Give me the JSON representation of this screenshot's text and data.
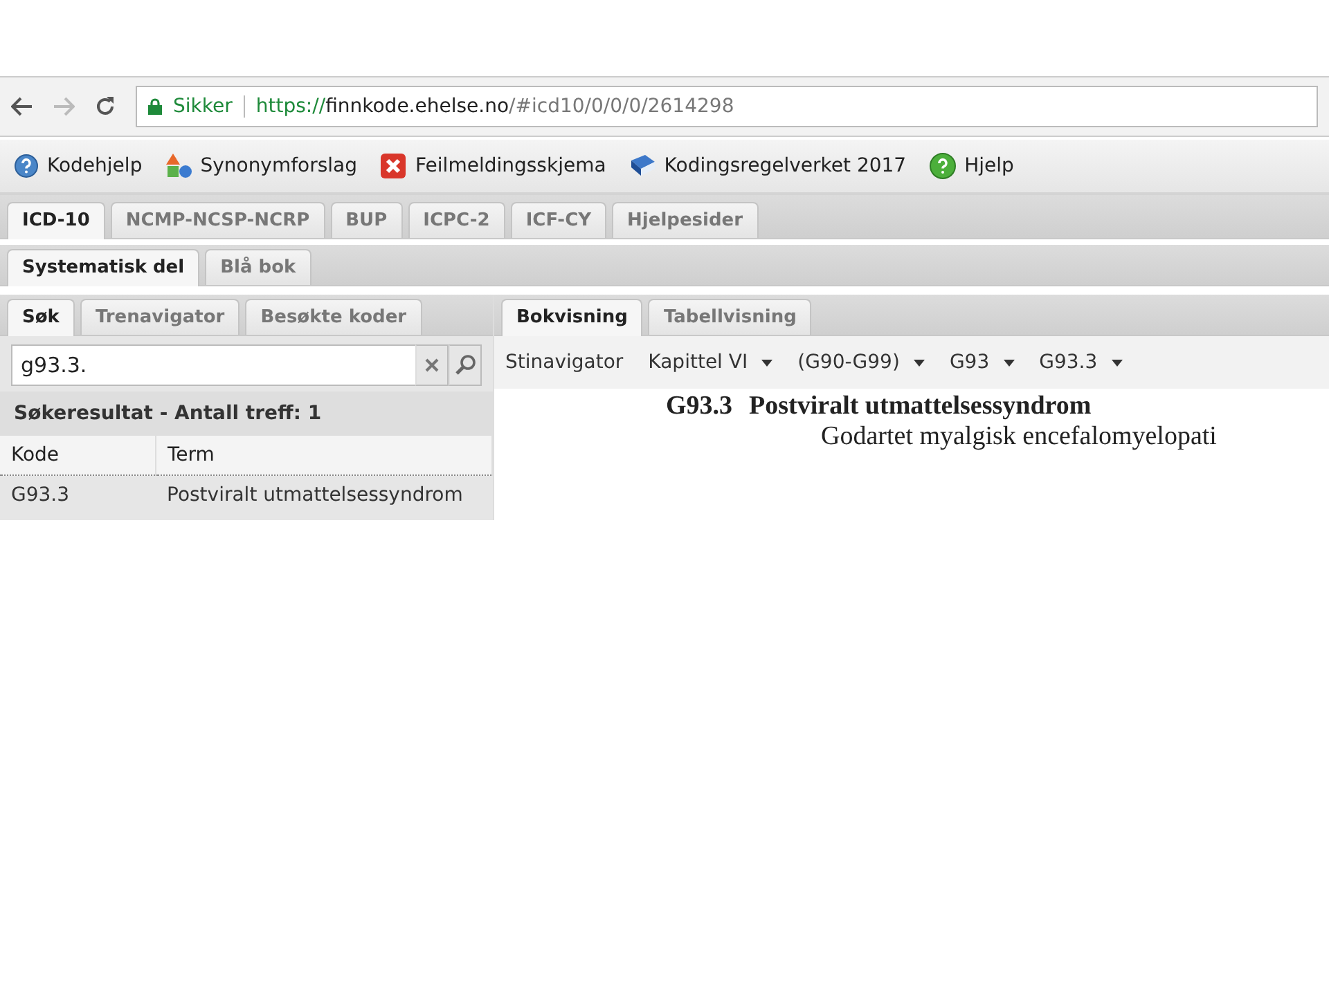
{
  "browser": {
    "security_label": "Sikker",
    "url": {
      "scheme": "https://",
      "host": "finnkode.ehelse.no",
      "path": "/#icd10/0/0/0/2614298"
    }
  },
  "toolbar": [
    {
      "kind": "help",
      "label": "Kodehjelp"
    },
    {
      "kind": "shapes",
      "label": "Synonymforslag"
    },
    {
      "kind": "error",
      "label": "Feilmeldingsskjema"
    },
    {
      "kind": "book",
      "label": "Kodingsregelverket 2017"
    },
    {
      "kind": "greenhelp",
      "label": "Hjelp"
    }
  ],
  "tabs": [
    {
      "label": "ICD-10",
      "selected": true
    },
    {
      "label": "NCMP-NCSP-NCRP",
      "selected": false
    },
    {
      "label": "BUP",
      "selected": false
    },
    {
      "label": "ICPC-2",
      "selected": false
    },
    {
      "label": "ICF-CY",
      "selected": false
    },
    {
      "label": "Hjelpesider",
      "selected": false
    }
  ],
  "subtabs": [
    {
      "label": "Systematisk del",
      "selected": true
    },
    {
      "label": "Blå bok",
      "selected": false
    }
  ],
  "left_panel": {
    "tabs": [
      {
        "label": "Søk",
        "selected": true
      },
      {
        "label": "Trenavigator",
        "selected": false
      },
      {
        "label": "Besøkte koder",
        "selected": false
      }
    ],
    "search": {
      "value": "g93.3."
    },
    "result_header": "Søkeresultat - Antall treff: 1",
    "columns": [
      "Kode",
      "Term"
    ],
    "rows": [
      [
        "G93.3",
        "Postviralt utmattelsessyndrom"
      ]
    ]
  },
  "right_panel": {
    "tabs": [
      {
        "label": "Bokvisning",
        "selected": true
      },
      {
        "label": "Tabellvisning",
        "selected": false
      }
    ],
    "breadcrumb_label": "Stinavigator",
    "breadcrumbs": [
      "Kapittel VI",
      "(G90-G99)",
      "G93",
      "G93.3"
    ],
    "entry": {
      "code": "G93.3",
      "title": "Postviralt utmattelsessyndrom",
      "synonym": "Godartet myalgisk encefalomyelopati"
    }
  }
}
